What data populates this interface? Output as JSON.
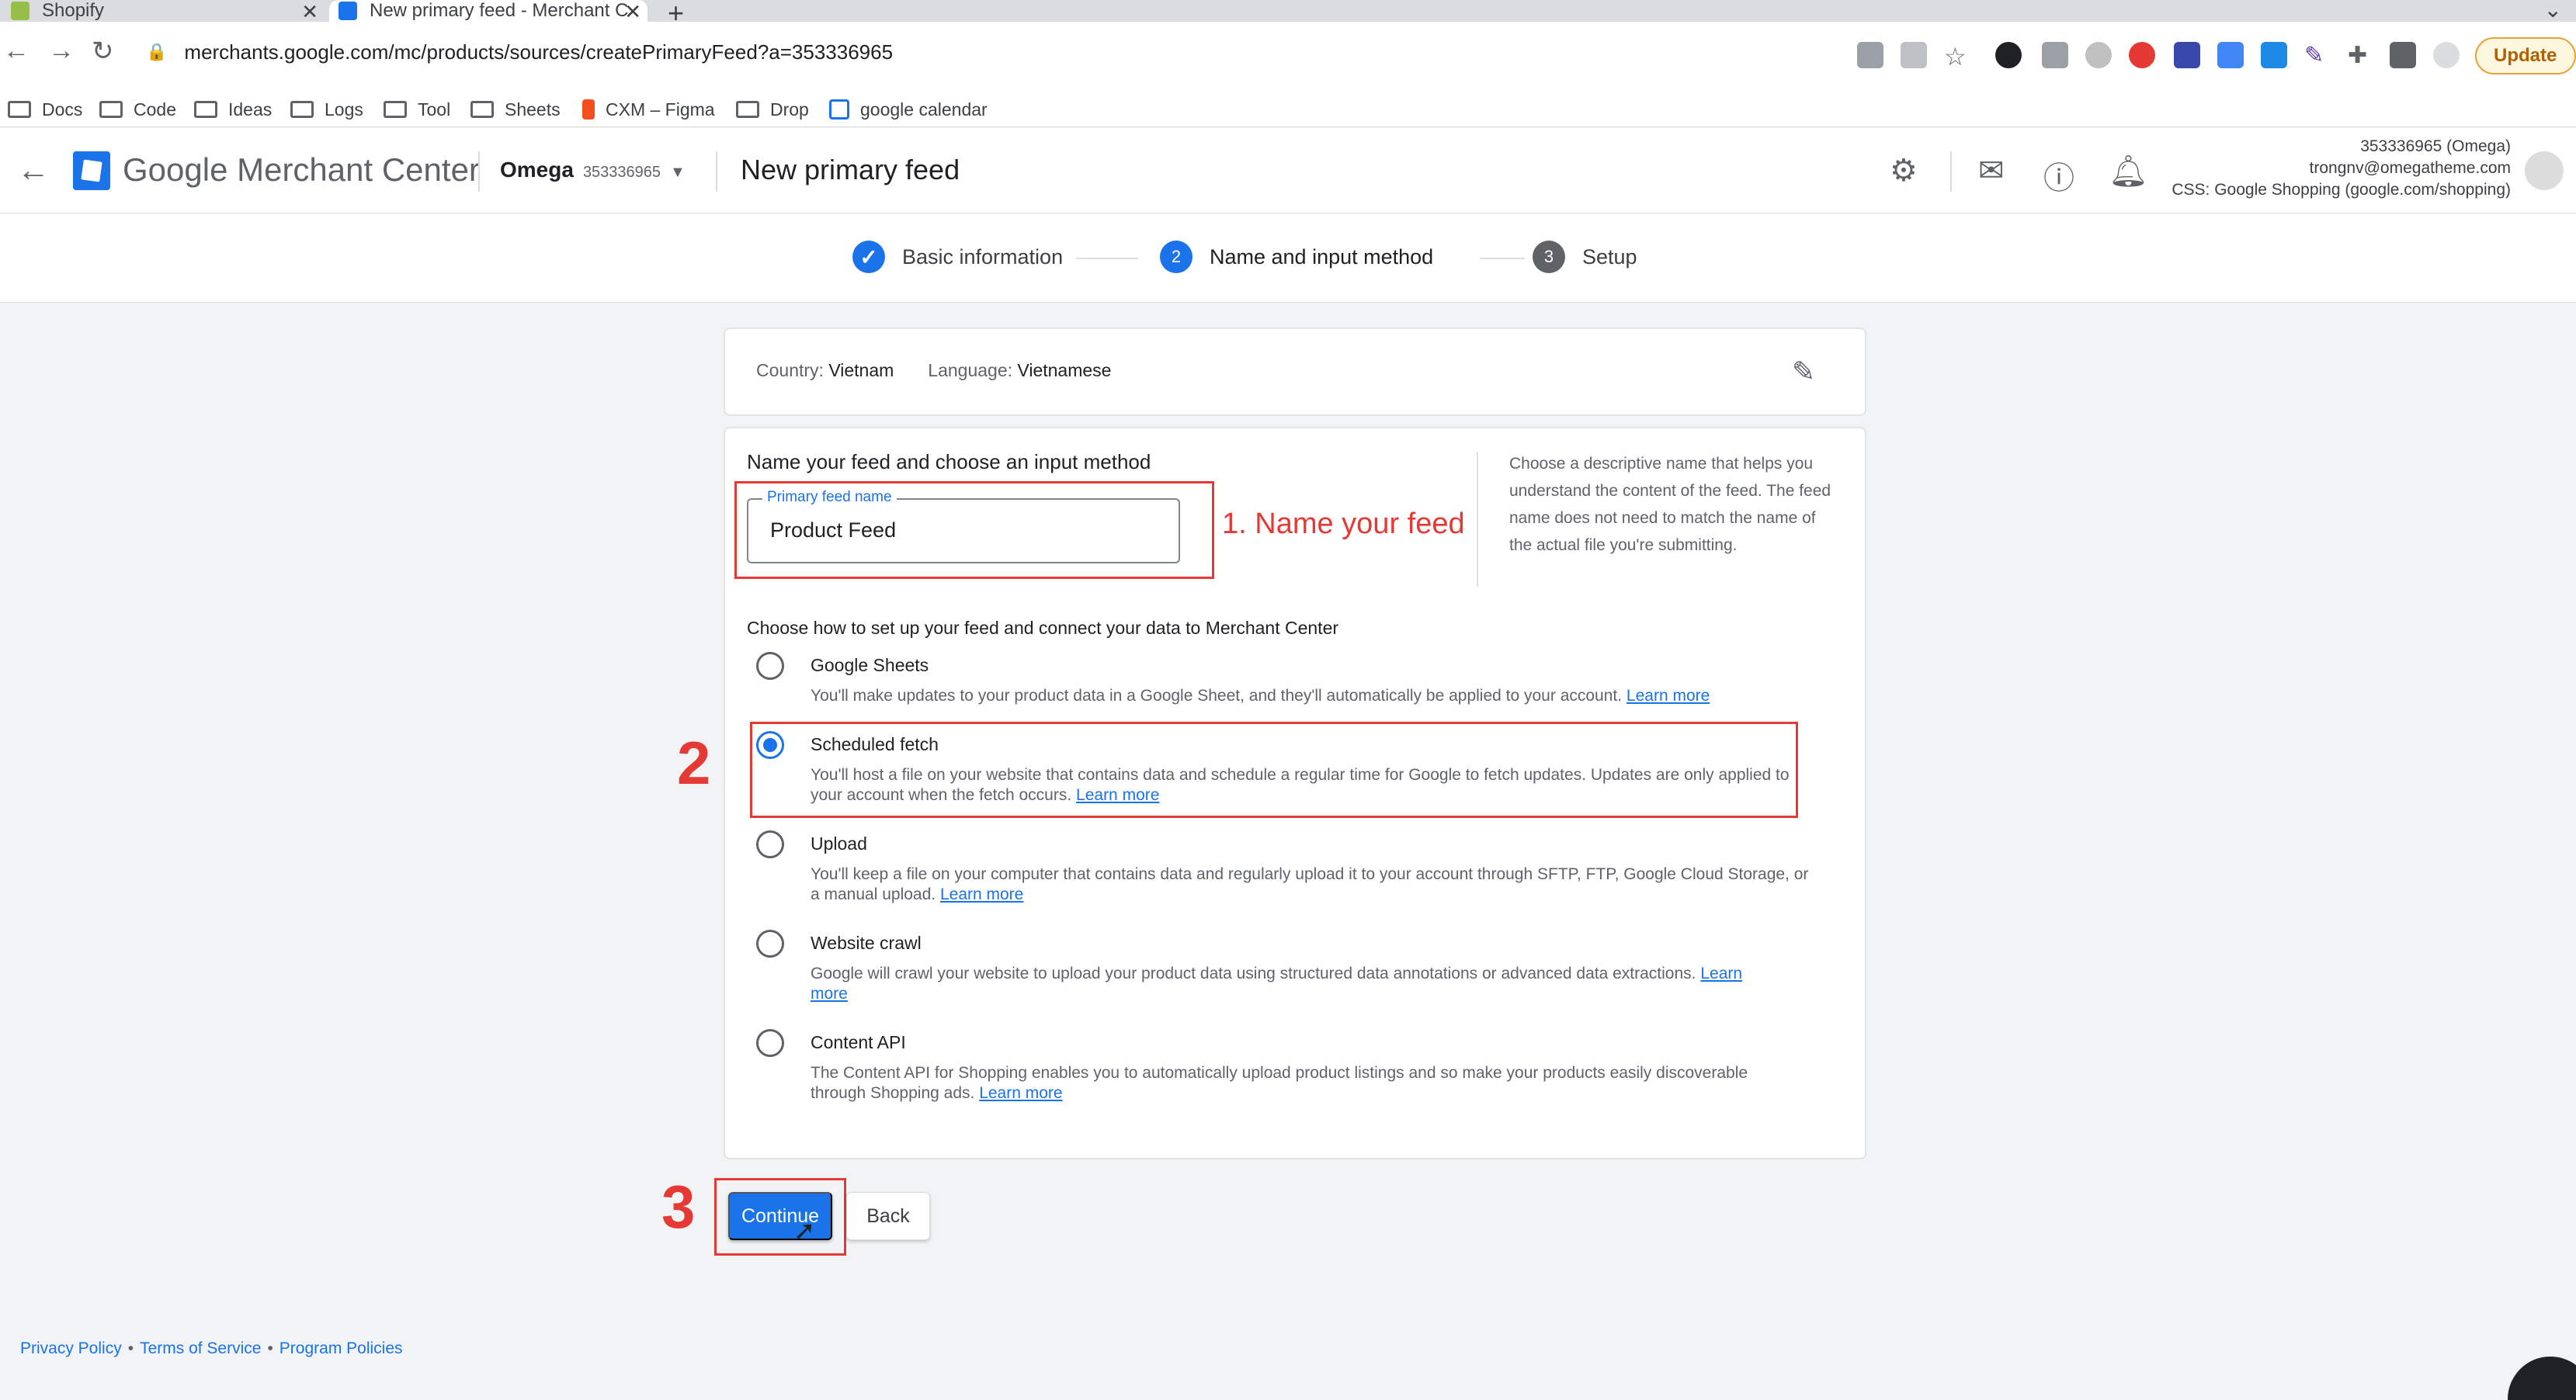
{
  "browser": {
    "tabs": [
      {
        "title": "Shopify",
        "active": false
      },
      {
        "title": "New primary feed - Merchant C",
        "active": true
      }
    ],
    "new_tab_label": "+",
    "url": "merchants.google.com/mc/products/sources/createPrimaryFeed?a=353336965",
    "update_label": "Update",
    "bookmarks": [
      "Docs",
      "Code",
      "Ideas",
      "Logs",
      "Tool",
      "Sheets",
      "CXM – Figma",
      "Drop",
      "google calendar"
    ]
  },
  "header": {
    "brand": "Google Merchant Center",
    "account_name": "Omega",
    "account_id": "353336965",
    "page_title": "New primary feed",
    "account_info": [
      "353336965 (Omega)",
      "trongnv@omegatheme.com",
      "CSS: Google Shopping (google.com/shopping)"
    ]
  },
  "stepper": {
    "steps": [
      {
        "label": "Basic information",
        "state": "done",
        "marker": "✓"
      },
      {
        "label": "Name and input method",
        "state": "active",
        "marker": "2"
      },
      {
        "label": "Setup",
        "state": "todo",
        "marker": "3"
      }
    ]
  },
  "summary": {
    "country_label": "Country:",
    "country": "Vietnam",
    "language_label": "Language:",
    "language": "Vietnamese"
  },
  "form": {
    "section_title": "Name your feed and choose an input method",
    "feed_name_label": "Primary feed name",
    "feed_name_value": "Product Feed",
    "help_text": "Choose a descriptive name that helps you understand the content of the feed. The feed name does not need to match the name of the actual file you're submitting.",
    "choose_title": "Choose how to set up your feed and connect your data to Merchant Center",
    "options": [
      {
        "name": "Google Sheets",
        "checked": false,
        "desc": "You'll make updates to your product data in a Google Sheet, and they'll automatically be applied to your account.",
        "link": "Learn more"
      },
      {
        "name": "Scheduled fetch",
        "checked": true,
        "desc": "You'll host a file on your website that contains data and schedule a regular time for Google to fetch updates. Updates are only applied to your account when the fetch occurs.",
        "link": "Learn more"
      },
      {
        "name": "Upload",
        "checked": false,
        "desc": "You'll keep a file on your computer that contains data and regularly upload it to your account through SFTP, FTP, Google Cloud Storage, or a manual upload.",
        "link": "Learn more"
      },
      {
        "name": "Website crawl",
        "checked": false,
        "desc": "Google will crawl your website to upload your product data using structured data annotations or advanced data extractions.",
        "link": "Learn more"
      },
      {
        "name": "Content API",
        "checked": false,
        "desc": "The Content API for Shopping enables you to automatically upload product listings and so make your products easily discoverable through Shopping ads.",
        "link": "Learn more"
      }
    ]
  },
  "annotations": {
    "name_feed": "1. Name your feed",
    "step2": "2",
    "step3": "3",
    "color": "#e53935"
  },
  "buttons": {
    "continue": "Continue",
    "back": "Back"
  },
  "footer": {
    "links": [
      "Privacy Policy",
      "Terms of Service",
      "Program Policies"
    ],
    "separator": "•"
  },
  "colors": {
    "primary": "#1a73e8",
    "annotation": "#e53935"
  }
}
